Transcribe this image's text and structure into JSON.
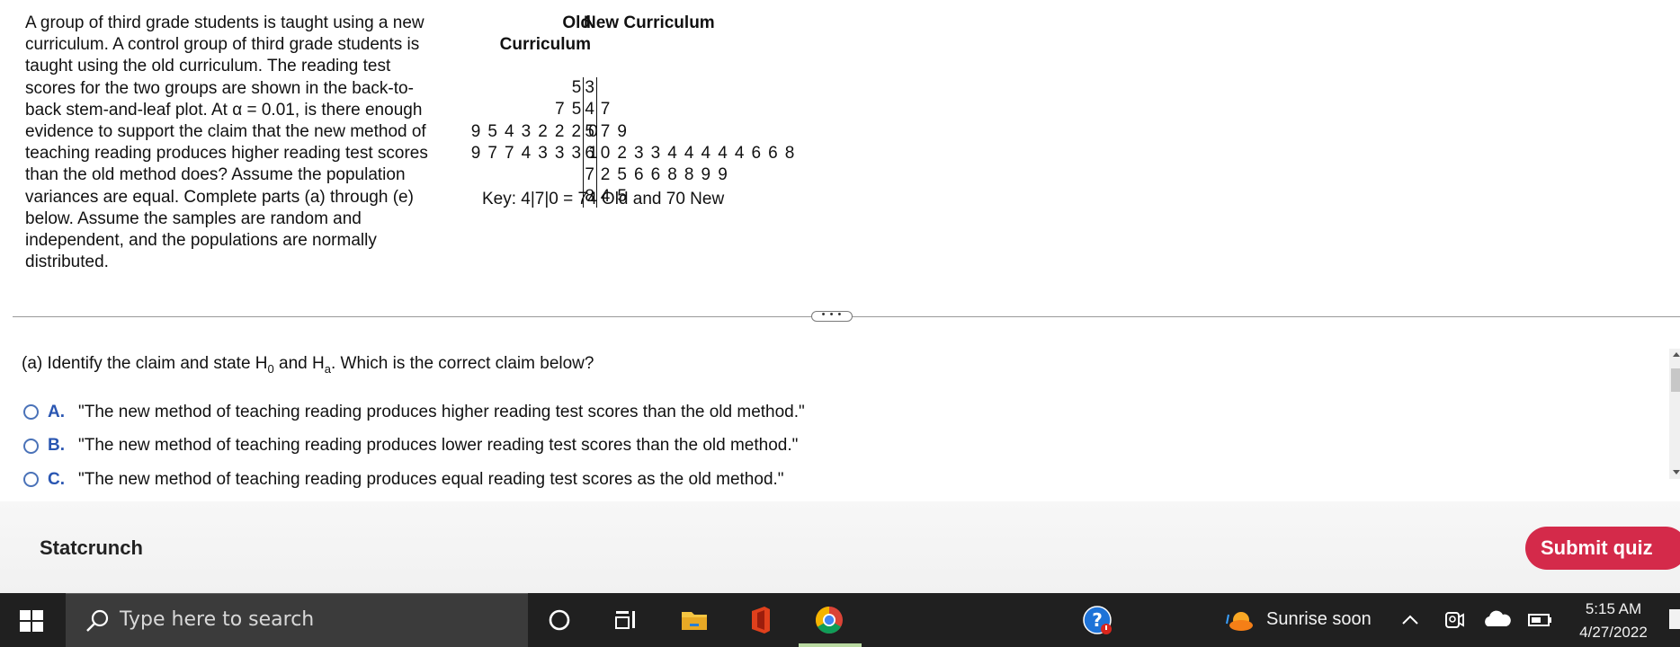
{
  "problem": {
    "text": "A group of third grade students is taught using a new curriculum. A control group of third grade students is taught using the old curriculum. The reading test scores for the two groups are shown in the back-to-back stem-and-leaf plot.  At α = 0.01, is there enough evidence to support the claim that the new method of teaching reading produces higher reading test scores than the old method does? Assume the population variances are equal. Complete parts (a) through (e) below.  Assume the samples are random and independent, and the populations are normally distributed."
  },
  "plot": {
    "header_old": "Old\nCurriculum",
    "header_new": "New Curriculum",
    "rows": [
      {
        "old": "5",
        "stem": "3",
        "new": ""
      },
      {
        "old": "7 5",
        "stem": "4",
        "new": "7"
      },
      {
        "old": "9 5 4 3 2 2 2 0",
        "stem": "5",
        "new": "7 9"
      },
      {
        "old": "9 7 7 4 3 3 3 1",
        "stem": "6",
        "new": "0 2 3 3 4 4 4 4 4 6 6 8"
      },
      {
        "old": "",
        "stem": "7",
        "new": "2 5 6 6 8 8 9 9"
      },
      {
        "old": "",
        "stem": "8",
        "new": "4 5"
      }
    ],
    "key": "Key: 4|7|0 = 74 Old and 70 New"
  },
  "divider": {
    "handle": "• • •"
  },
  "part_a": {
    "prefix": "(a) Identify the claim and state H",
    "sub0": "0",
    "mid": " and H",
    "suba": "a",
    "suffix": ". Which is the correct claim below?"
  },
  "options": [
    {
      "letter": "A.",
      "text": "\"The new method of teaching reading produces higher reading test scores than the old method.\""
    },
    {
      "letter": "B.",
      "text": "\"The new method of teaching reading produces lower reading test scores than the old method.\""
    },
    {
      "letter": "C.",
      "text": "\"The new method of teaching reading produces equal reading test scores as the old method.\""
    }
  ],
  "footer": {
    "title": "Statcrunch",
    "submit_label": "Submit quiz"
  },
  "taskbar": {
    "search_placeholder": "Type here to search",
    "weather": "Sunrise soon",
    "time": "5:15 AM",
    "date": "4/27/2022",
    "icons": [
      "windows-start-icon",
      "search-icon",
      "cortana-icon",
      "task-view-icon",
      "file-explorer-icon",
      "office-icon",
      "chrome-icon",
      "help-icon",
      "weather-icon",
      "chevron-up-icon",
      "meet-now-icon",
      "onedrive-icon",
      "battery-icon",
      "notifications-icon"
    ]
  },
  "colors": {
    "accent_blue": "#2a56b2",
    "submit_red": "#d42a4a",
    "taskbar": "#202020"
  }
}
